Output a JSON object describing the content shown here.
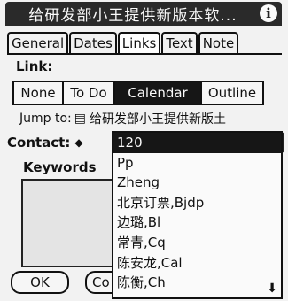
{
  "window": {
    "title": "给研发部小王提供新版本软..."
  },
  "tabs": [
    {
      "label": "General",
      "active": false
    },
    {
      "label": "Dates",
      "active": false
    },
    {
      "label": "Links",
      "active": true
    },
    {
      "label": "Text",
      "active": false
    },
    {
      "label": "Note",
      "active": false
    }
  ],
  "link": {
    "label": "Link:",
    "options": [
      {
        "label": "None",
        "selected": false
      },
      {
        "label": "To Do",
        "selected": false
      },
      {
        "label": "Calendar",
        "selected": true
      },
      {
        "label": "Outline",
        "selected": false
      }
    ]
  },
  "jump": {
    "label": "Jump to:",
    "icon": "document-link-icon",
    "value": "给研发部小王提供新版土"
  },
  "contact": {
    "label": "Contact:",
    "icon": "diamond-icon"
  },
  "keywords": {
    "label": "Keywords"
  },
  "buttons": {
    "ok": "OK",
    "second": "Co"
  },
  "dropdown": {
    "items": [
      "120",
      "Pp",
      "Zheng",
      "北京订票,Bjdp",
      "边璐,Bl",
      "常青,Cq",
      "陈安龙,Cal",
      "陈衡,Ch"
    ],
    "selected_index": 0,
    "scroll_icon": "scroll-down-arrow-icon"
  },
  "colors": {
    "selected_bg": "#161616",
    "title_bg": "#2a2a2a"
  }
}
